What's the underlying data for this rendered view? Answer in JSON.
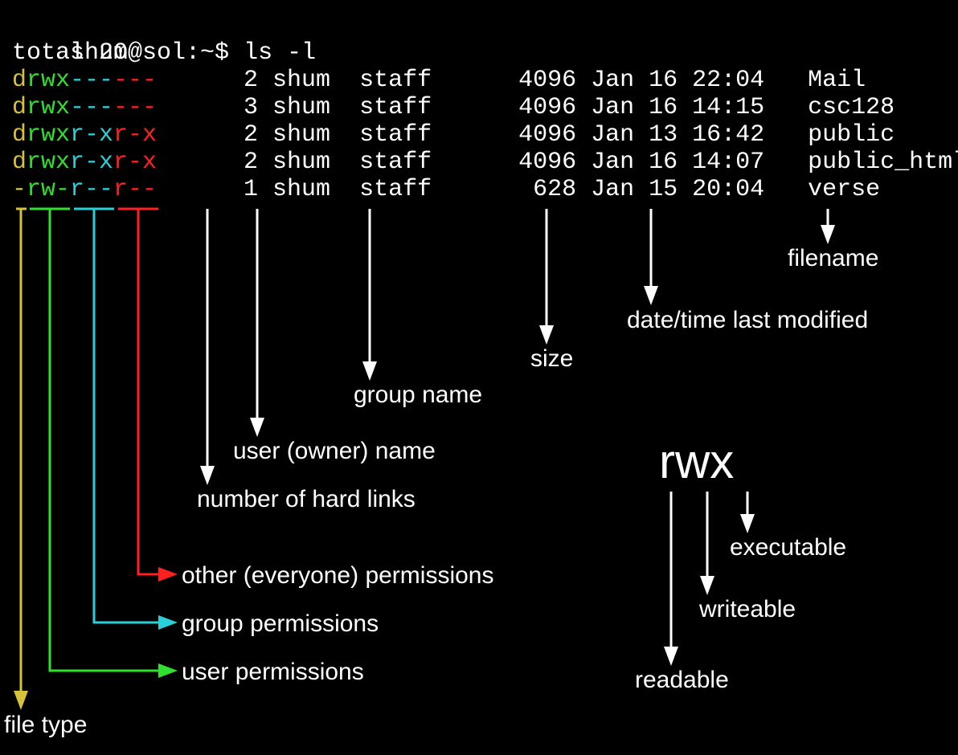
{
  "prompt": {
    "user_host": "shum@sol",
    "cwd_sep": ":~$ ",
    "command": "ls -l"
  },
  "total_line": "total 20",
  "rows": [
    {
      "type": "d",
      "user": "rwx",
      "group": "---",
      "other": "---",
      "links": "2",
      "owner": "shum",
      "grp": "staff",
      "size": "4096",
      "date": "Jan 16 22:04",
      "name": "Mail"
    },
    {
      "type": "d",
      "user": "rwx",
      "group": "---",
      "other": "---",
      "links": "3",
      "owner": "shum",
      "grp": "staff",
      "size": "4096",
      "date": "Jan 16 14:15",
      "name": "csc128"
    },
    {
      "type": "d",
      "user": "rwx",
      "group": "r-x",
      "other": "r-x",
      "links": "2",
      "owner": "shum",
      "grp": "staff",
      "size": "4096",
      "date": "Jan 13 16:42",
      "name": "public"
    },
    {
      "type": "d",
      "user": "rwx",
      "group": "r-x",
      "other": "r-x",
      "links": "2",
      "owner": "shum",
      "grp": "staff",
      "size": "4096",
      "date": "Jan 16 14:07",
      "name": "public_html"
    },
    {
      "type": "-",
      "user": "rw-",
      "group": "r--",
      "other": "r--",
      "links": "1",
      "owner": "shum",
      "grp": "staff",
      "size": "628",
      "date": "Jan 15 20:04",
      "name": "verse"
    }
  ],
  "labels": {
    "filetype": "file type",
    "user_perm": "user permissions",
    "group_perm": "group permissions",
    "other_perm": "other (everyone) permissions",
    "links": "number of hard links",
    "owner": "user (owner) name",
    "grp": "group name",
    "size": "size",
    "date": "date/time last modified",
    "filename": "filename",
    "rwx": "rwx",
    "readable": "readable",
    "writeable": "writeable",
    "executable": "executable"
  },
  "colors": {
    "filetype": "#d6c23a",
    "user": "#2fe02f",
    "group": "#29d0d8",
    "other": "#ff2020",
    "white": "#ffffff"
  }
}
